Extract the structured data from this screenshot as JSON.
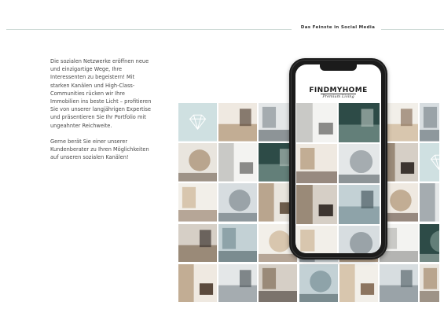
{
  "header": {
    "title": "Das Feinste in Social Media"
  },
  "intro": {
    "paragraph1": "Die sozialen Netzwerke eröffnen neue und einzigartige Wege, Ihre Interessenten zu begeistern! Mit starken Kanälen und High-Class-Communities rücken wir Ihre Immobilien ins beste Licht – profitieren Sie von unserer langjährigen Expertise und präsentieren Sie Ihr Portfolio mit ungeahnter Reichweite.",
    "paragraph2": "Gerne berät Sie einer unserer Kundenberater zu Ihren Möglichkeiten auf unseren sozialen Kanälen!"
  },
  "phone": {
    "brand": "FINDMYHOME",
    "tagline": "Premium Living"
  },
  "colors": {
    "accent_teal": "#cfe0e1",
    "rule": "#cfdcd8",
    "dark_green": "#2c4a46",
    "wood": "#a57a55"
  },
  "icons": {
    "tile_logo": "diamond-icon"
  }
}
